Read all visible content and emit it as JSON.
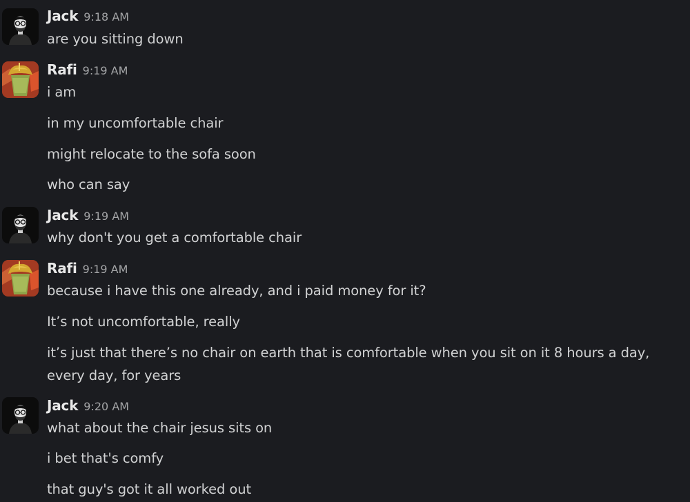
{
  "groups": [
    {
      "author": "Jack",
      "time": "9:18 AM",
      "avatar_icon": "man-with-glasses-avatar",
      "messages": [
        "are you sitting down"
      ]
    },
    {
      "author": "Rafi",
      "time": "9:19 AM",
      "avatar_icon": "green-drink-avatar",
      "messages": [
        "i am",
        "in my uncomfortable chair",
        "might relocate to the sofa soon",
        "who can say"
      ]
    },
    {
      "author": "Jack",
      "time": "9:19 AM",
      "avatar_icon": "man-with-glasses-avatar",
      "messages": [
        "why don't you get a comfortable chair"
      ]
    },
    {
      "author": "Rafi",
      "time": "9:19 AM",
      "avatar_icon": "green-drink-avatar",
      "messages": [
        "because i have this one already, and i paid money for it?",
        "It’s not uncomfortable, really",
        "it’s just that there’s no chair on earth that is comfortable when you sit on it 8 hours a day, every day, for years"
      ]
    },
    {
      "author": "Jack",
      "time": "9:20 AM",
      "avatar_icon": "man-with-glasses-avatar",
      "messages": [
        "what about the chair jesus sits on",
        "i bet that's comfy",
        "that guy's got it all worked out"
      ]
    }
  ]
}
